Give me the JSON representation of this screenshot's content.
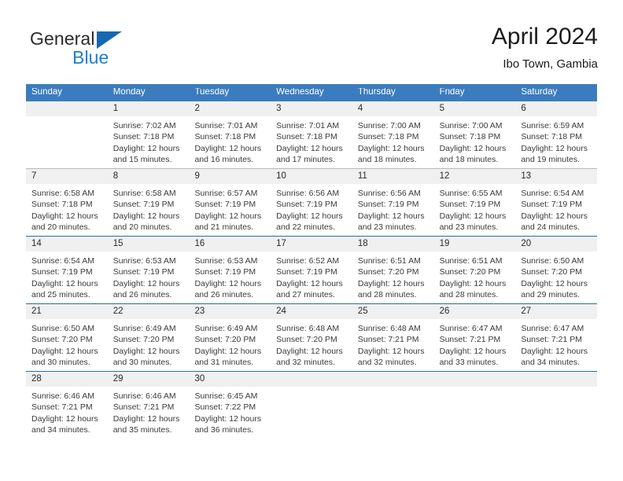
{
  "brand": {
    "word1": "General",
    "word2": "Blue",
    "flag_color": "#1668b3",
    "blue_color": "#1b7fd4"
  },
  "header": {
    "title": "April 2024",
    "subtitle": "Ibo Town, Gambia"
  },
  "theme": {
    "header_bg": "#3b7cbe",
    "header_text": "#ffffff",
    "daynum_band": "#f0f0f0",
    "row_rule_blue": "#2d6ca8",
    "row_rule_gray": "#b9b9b9"
  },
  "weekdays": [
    "Sunday",
    "Monday",
    "Tuesday",
    "Wednesday",
    "Thursday",
    "Friday",
    "Saturday"
  ],
  "labels": {
    "sunrise": "Sunrise:",
    "sunset": "Sunset:",
    "daylight": "Daylight:"
  },
  "weeks": [
    {
      "rule": "none",
      "days": [
        {
          "num": "",
          "empty": true
        },
        {
          "num": "1",
          "sunrise": "Sunrise: 7:02 AM",
          "sunset": "Sunset: 7:18 PM",
          "daylight1": "Daylight: 12 hours",
          "daylight2": "and 15 minutes."
        },
        {
          "num": "2",
          "sunrise": "Sunrise: 7:01 AM",
          "sunset": "Sunset: 7:18 PM",
          "daylight1": "Daylight: 12 hours",
          "daylight2": "and 16 minutes."
        },
        {
          "num": "3",
          "sunrise": "Sunrise: 7:01 AM",
          "sunset": "Sunset: 7:18 PM",
          "daylight1": "Daylight: 12 hours",
          "daylight2": "and 17 minutes."
        },
        {
          "num": "4",
          "sunrise": "Sunrise: 7:00 AM",
          "sunset": "Sunset: 7:18 PM",
          "daylight1": "Daylight: 12 hours",
          "daylight2": "and 18 minutes."
        },
        {
          "num": "5",
          "sunrise": "Sunrise: 7:00 AM",
          "sunset": "Sunset: 7:18 PM",
          "daylight1": "Daylight: 12 hours",
          "daylight2": "and 18 minutes."
        },
        {
          "num": "6",
          "sunrise": "Sunrise: 6:59 AM",
          "sunset": "Sunset: 7:18 PM",
          "daylight1": "Daylight: 12 hours",
          "daylight2": "and 19 minutes."
        }
      ]
    },
    {
      "rule": "gray",
      "days": [
        {
          "num": "7",
          "sunrise": "Sunrise: 6:58 AM",
          "sunset": "Sunset: 7:18 PM",
          "daylight1": "Daylight: 12 hours",
          "daylight2": "and 20 minutes."
        },
        {
          "num": "8",
          "sunrise": "Sunrise: 6:58 AM",
          "sunset": "Sunset: 7:19 PM",
          "daylight1": "Daylight: 12 hours",
          "daylight2": "and 20 minutes."
        },
        {
          "num": "9",
          "sunrise": "Sunrise: 6:57 AM",
          "sunset": "Sunset: 7:19 PM",
          "daylight1": "Daylight: 12 hours",
          "daylight2": "and 21 minutes."
        },
        {
          "num": "10",
          "sunrise": "Sunrise: 6:56 AM",
          "sunset": "Sunset: 7:19 PM",
          "daylight1": "Daylight: 12 hours",
          "daylight2": "and 22 minutes."
        },
        {
          "num": "11",
          "sunrise": "Sunrise: 6:56 AM",
          "sunset": "Sunset: 7:19 PM",
          "daylight1": "Daylight: 12 hours",
          "daylight2": "and 23 minutes."
        },
        {
          "num": "12",
          "sunrise": "Sunrise: 6:55 AM",
          "sunset": "Sunset: 7:19 PM",
          "daylight1": "Daylight: 12 hours",
          "daylight2": "and 23 minutes."
        },
        {
          "num": "13",
          "sunrise": "Sunrise: 6:54 AM",
          "sunset": "Sunset: 7:19 PM",
          "daylight1": "Daylight: 12 hours",
          "daylight2": "and 24 minutes."
        }
      ]
    },
    {
      "rule": "blue",
      "days": [
        {
          "num": "14",
          "sunrise": "Sunrise: 6:54 AM",
          "sunset": "Sunset: 7:19 PM",
          "daylight1": "Daylight: 12 hours",
          "daylight2": "and 25 minutes."
        },
        {
          "num": "15",
          "sunrise": "Sunrise: 6:53 AM",
          "sunset": "Sunset: 7:19 PM",
          "daylight1": "Daylight: 12 hours",
          "daylight2": "and 26 minutes."
        },
        {
          "num": "16",
          "sunrise": "Sunrise: 6:53 AM",
          "sunset": "Sunset: 7:19 PM",
          "daylight1": "Daylight: 12 hours",
          "daylight2": "and 26 minutes."
        },
        {
          "num": "17",
          "sunrise": "Sunrise: 6:52 AM",
          "sunset": "Sunset: 7:19 PM",
          "daylight1": "Daylight: 12 hours",
          "daylight2": "and 27 minutes."
        },
        {
          "num": "18",
          "sunrise": "Sunrise: 6:51 AM",
          "sunset": "Sunset: 7:20 PM",
          "daylight1": "Daylight: 12 hours",
          "daylight2": "and 28 minutes."
        },
        {
          "num": "19",
          "sunrise": "Sunrise: 6:51 AM",
          "sunset": "Sunset: 7:20 PM",
          "daylight1": "Daylight: 12 hours",
          "daylight2": "and 28 minutes."
        },
        {
          "num": "20",
          "sunrise": "Sunrise: 6:50 AM",
          "sunset": "Sunset: 7:20 PM",
          "daylight1": "Daylight: 12 hours",
          "daylight2": "and 29 minutes."
        }
      ]
    },
    {
      "rule": "blue",
      "days": [
        {
          "num": "21",
          "sunrise": "Sunrise: 6:50 AM",
          "sunset": "Sunset: 7:20 PM",
          "daylight1": "Daylight: 12 hours",
          "daylight2": "and 30 minutes."
        },
        {
          "num": "22",
          "sunrise": "Sunrise: 6:49 AM",
          "sunset": "Sunset: 7:20 PM",
          "daylight1": "Daylight: 12 hours",
          "daylight2": "and 30 minutes."
        },
        {
          "num": "23",
          "sunrise": "Sunrise: 6:49 AM",
          "sunset": "Sunset: 7:20 PM",
          "daylight1": "Daylight: 12 hours",
          "daylight2": "and 31 minutes."
        },
        {
          "num": "24",
          "sunrise": "Sunrise: 6:48 AM",
          "sunset": "Sunset: 7:20 PM",
          "daylight1": "Daylight: 12 hours",
          "daylight2": "and 32 minutes."
        },
        {
          "num": "25",
          "sunrise": "Sunrise: 6:48 AM",
          "sunset": "Sunset: 7:21 PM",
          "daylight1": "Daylight: 12 hours",
          "daylight2": "and 32 minutes."
        },
        {
          "num": "26",
          "sunrise": "Sunrise: 6:47 AM",
          "sunset": "Sunset: 7:21 PM",
          "daylight1": "Daylight: 12 hours",
          "daylight2": "and 33 minutes."
        },
        {
          "num": "27",
          "sunrise": "Sunrise: 6:47 AM",
          "sunset": "Sunset: 7:21 PM",
          "daylight1": "Daylight: 12 hours",
          "daylight2": "and 34 minutes."
        }
      ]
    },
    {
      "rule": "blue",
      "days": [
        {
          "num": "28",
          "sunrise": "Sunrise: 6:46 AM",
          "sunset": "Sunset: 7:21 PM",
          "daylight1": "Daylight: 12 hours",
          "daylight2": "and 34 minutes."
        },
        {
          "num": "29",
          "sunrise": "Sunrise: 6:46 AM",
          "sunset": "Sunset: 7:21 PM",
          "daylight1": "Daylight: 12 hours",
          "daylight2": "and 35 minutes."
        },
        {
          "num": "30",
          "sunrise": "Sunrise: 6:45 AM",
          "sunset": "Sunset: 7:22 PM",
          "daylight1": "Daylight: 12 hours",
          "daylight2": "and 36 minutes."
        },
        {
          "num": "",
          "empty": true
        },
        {
          "num": "",
          "empty": true
        },
        {
          "num": "",
          "empty": true
        },
        {
          "num": "",
          "empty": true
        }
      ]
    }
  ]
}
